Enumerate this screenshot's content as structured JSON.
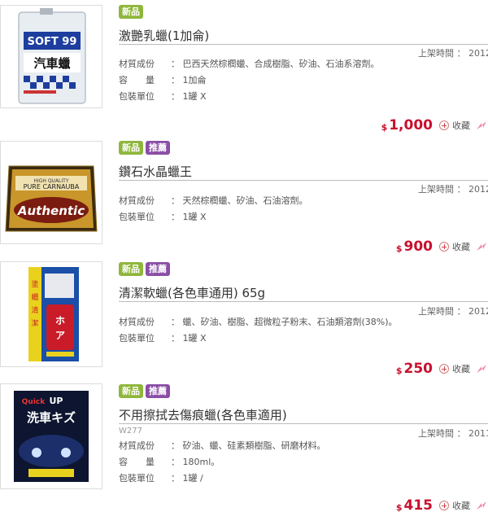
{
  "products": [
    {
      "image_name": "soft99-car-wax-can",
      "badges": [
        {
          "label": "新品",
          "kind": "new"
        }
      ],
      "title": "激艷乳蠟(1加侖)",
      "code": "",
      "date_label": "上架時間 ： 2012",
      "specs": [
        {
          "label": "材質成份",
          "value": "： 巴西天然棕櫚蠟、合成樹脂、矽油、石油系溶劑。"
        },
        {
          "label": "容　　量",
          "value": "： 1加侖"
        },
        {
          "label": "包裝單位",
          "value": "： 1罐 X"
        }
      ],
      "currency": "$",
      "price": "1,000",
      "fav_label": "收藏"
    },
    {
      "image_name": "authentic-carnauba-wax-box",
      "badges": [
        {
          "label": "新品",
          "kind": "new"
        },
        {
          "label": "推薦",
          "kind": "rec"
        }
      ],
      "title": "鑽石水晶蠟王",
      "code": "",
      "date_label": "上架時間 ： 2012",
      "specs": [
        {
          "label": "材質成份",
          "value": "： 天然棕櫚蠟、矽油、石油溶劑。"
        },
        {
          "label": "包裝單位",
          "value": "： 1罐 X"
        }
      ],
      "currency": "$",
      "price": "900",
      "fav_label": "收藏"
    },
    {
      "image_name": "soft-wax-tube-package",
      "badges": [
        {
          "label": "新品",
          "kind": "new"
        },
        {
          "label": "推薦",
          "kind": "rec"
        }
      ],
      "title": "清潔軟蠟(各色車通用) 65g",
      "code": "",
      "date_label": "上架時間 ： 2012",
      "specs": [
        {
          "label": "材質成份",
          "value": "： 蠟、矽油、樹脂、超微粒子粉末、石油類溶劑(38%)。"
        },
        {
          "label": "包裝單位",
          "value": "： 1罐 X"
        }
      ],
      "currency": "$",
      "price": "250",
      "fav_label": "收藏"
    },
    {
      "image_name": "quick-up-wash-wax-box",
      "badges": [
        {
          "label": "新品",
          "kind": "new"
        },
        {
          "label": "推薦",
          "kind": "rec"
        }
      ],
      "title": "不用擦拭去傷痕蠟(各色車適用)",
      "code": "W277",
      "date_label": "上架時間 ： 2011",
      "specs": [
        {
          "label": "材質成份",
          "value": "： 矽油、蠟、硅素類樹脂、研磨材料。"
        },
        {
          "label": "容　　量",
          "value": "： 180ml。"
        },
        {
          "label": "包裝單位",
          "value": "： 1罐 /"
        }
      ],
      "currency": "$",
      "price": "415",
      "fav_label": "收藏"
    }
  ],
  "colors": {
    "price": "#c8102e",
    "badge_new": "#8fb63c",
    "badge_rec": "#8a4ea6"
  }
}
